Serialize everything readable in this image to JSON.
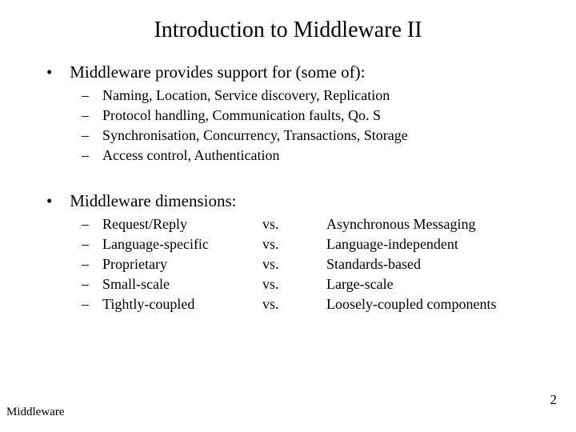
{
  "title": "Introduction to Middleware II",
  "bullets": [
    {
      "text": "Middleware provides support for (some of):",
      "sub": [
        "Naming, Location, Service discovery, Replication",
        "Protocol handling, Communication faults, Qo. S",
        "Synchronisation, Concurrency, Transactions, Storage",
        "Access control, Authentication"
      ]
    },
    {
      "text": "Middleware dimensions:",
      "dims": [
        {
          "left": "Request/Reply",
          "vs": "vs.",
          "right": "Asynchronous Messaging"
        },
        {
          "left": "Language-specific",
          "vs": " vs.",
          "right": "Language-independent"
        },
        {
          "left": "Proprietary",
          "vs": "vs.",
          "right": "Standards-based"
        },
        {
          "left": "Small-scale",
          "vs": "vs.",
          "right": "Large-scale"
        },
        {
          "left": "Tightly-coupled",
          "vs": "vs.",
          "right": "Loosely-coupled components"
        }
      ]
    }
  ],
  "footer": "Middleware",
  "page": "2"
}
